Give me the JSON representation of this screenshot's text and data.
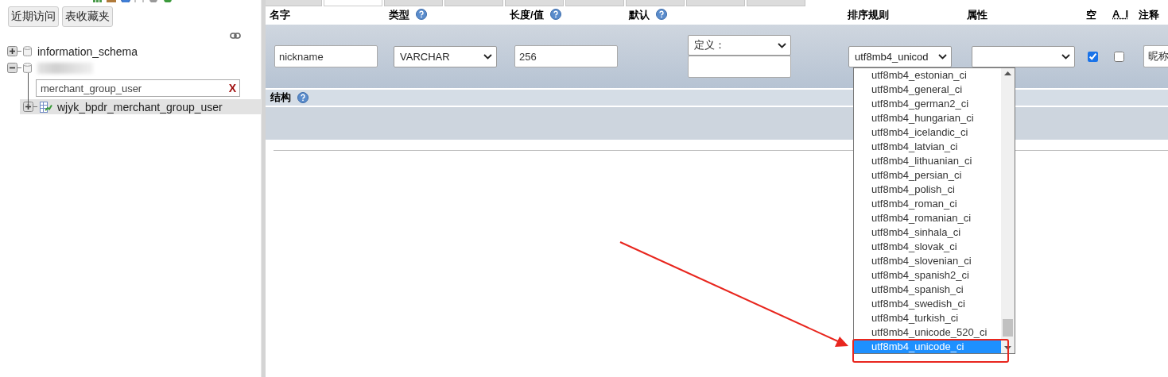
{
  "tabs": [
    {
      "selected": false
    },
    {
      "selected": true
    },
    {
      "selected": false
    },
    {
      "selected": false
    },
    {
      "selected": false
    },
    {
      "selected": false
    },
    {
      "selected": false
    },
    {
      "selected": false
    },
    {
      "selected": false
    }
  ],
  "sidebar": {
    "buttons": [
      "近期访问",
      "表收藏夹"
    ],
    "tree": [
      {
        "label": "information_schema",
        "expanded": false
      },
      {
        "blurred": true,
        "expanded": true,
        "filter": {
          "value": "merchant_group_user",
          "clear_label": "X"
        },
        "children": [
          {
            "label": "wjyk_bpdr_merchant_group_user",
            "expanded": false,
            "selected": true
          }
        ]
      }
    ]
  },
  "columns": [
    {
      "label": "名字",
      "help": false
    },
    {
      "label": "类型",
      "help": true
    },
    {
      "label": "长度/值",
      "help": true
    },
    {
      "label": "默认",
      "help": true
    },
    {
      "label": "排序规则",
      "help": false
    },
    {
      "label": "属性",
      "help": false
    },
    {
      "label": "空",
      "help": false
    },
    {
      "label": "A_I",
      "help": false
    },
    {
      "label": "注释",
      "help": false
    }
  ],
  "row": {
    "name": "nickname",
    "type": "VARCHAR",
    "length": "256",
    "default": "定义：",
    "collation": "utf8mb4_unicod",
    "null": true,
    "ai": false,
    "comment": "昵称"
  },
  "structure": {
    "label": "结构",
    "help": true
  },
  "collation_list": {
    "options": [
      {
        "label": "utf8mb4_estonian_ci",
        "selected": false
      },
      {
        "label": "utf8mb4_general_ci",
        "selected": false
      },
      {
        "label": "utf8mb4_german2_ci",
        "selected": false
      },
      {
        "label": "utf8mb4_hungarian_ci",
        "selected": false
      },
      {
        "label": "utf8mb4_icelandic_ci",
        "selected": false
      },
      {
        "label": "utf8mb4_latvian_ci",
        "selected": false
      },
      {
        "label": "utf8mb4_lithuanian_ci",
        "selected": false
      },
      {
        "label": "utf8mb4_persian_ci",
        "selected": false
      },
      {
        "label": "utf8mb4_polish_ci",
        "selected": false
      },
      {
        "label": "utf8mb4_roman_ci",
        "selected": false
      },
      {
        "label": "utf8mb4_romanian_ci",
        "selected": false
      },
      {
        "label": "utf8mb4_sinhala_ci",
        "selected": false
      },
      {
        "label": "utf8mb4_slovak_ci",
        "selected": false
      },
      {
        "label": "utf8mb4_slovenian_ci",
        "selected": false
      },
      {
        "label": "utf8mb4_spanish2_ci",
        "selected": false
      },
      {
        "label": "utf8mb4_spanish_ci",
        "selected": false
      },
      {
        "label": "utf8mb4_swedish_ci",
        "selected": false
      },
      {
        "label": "utf8mb4_turkish_ci",
        "selected": false
      },
      {
        "label": "utf8mb4_unicode_520_ci",
        "selected": false
      },
      {
        "label": "utf8mb4_unicode_ci",
        "selected": true
      }
    ]
  },
  "annotation": {
    "kind": "arrow_and_box"
  }
}
